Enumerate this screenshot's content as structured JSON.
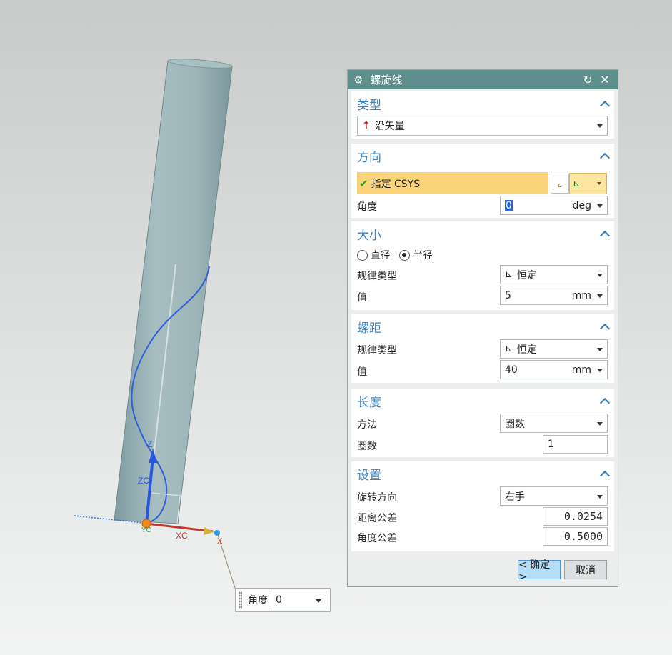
{
  "dialog": {
    "title": "螺旋线",
    "type_section": {
      "heading": "类型",
      "type_value": "沿矢量"
    },
    "direction_section": {
      "heading": "方向",
      "csys_label": "指定 CSYS",
      "angle_label": "角度",
      "angle_value": "0",
      "angle_unit": "deg"
    },
    "size_section": {
      "heading": "大小",
      "radio_diameter": "直径",
      "radio_radius": "半径",
      "selected": "半径",
      "law_type_label": "规律类型",
      "law_type_value": "恒定",
      "value_label": "值",
      "value": "5",
      "unit": "mm"
    },
    "pitch_section": {
      "heading": "螺距",
      "law_type_label": "规律类型",
      "law_type_value": "恒定",
      "value_label": "值",
      "value": "40",
      "unit": "mm"
    },
    "length_section": {
      "heading": "长度",
      "method_label": "方法",
      "method_value": "圈数",
      "turns_label": "圈数",
      "turns_value": "1"
    },
    "settings_section": {
      "heading": "设置",
      "handedness_label": "旋转方向",
      "handedness_value": "右手",
      "distance_tol_label": "距离公差",
      "distance_tol_value": "0.0254",
      "angle_tol_label": "角度公差",
      "angle_tol_value": "0.5000"
    },
    "ok_label": "< 确定 >",
    "cancel_label": "取消"
  },
  "viewport": {
    "axis_z": "Z",
    "axis_zc": "ZC",
    "axis_xc": "XC",
    "axis_x": "X",
    "axis_yc": "YC"
  },
  "floating_angle": {
    "label": "角度",
    "value": "0"
  },
  "colors": {
    "title_bar": "#5f8f8c",
    "heading": "#3a84c9",
    "csys_highlight": "#fbd479",
    "helix": "#2f5fd8"
  }
}
